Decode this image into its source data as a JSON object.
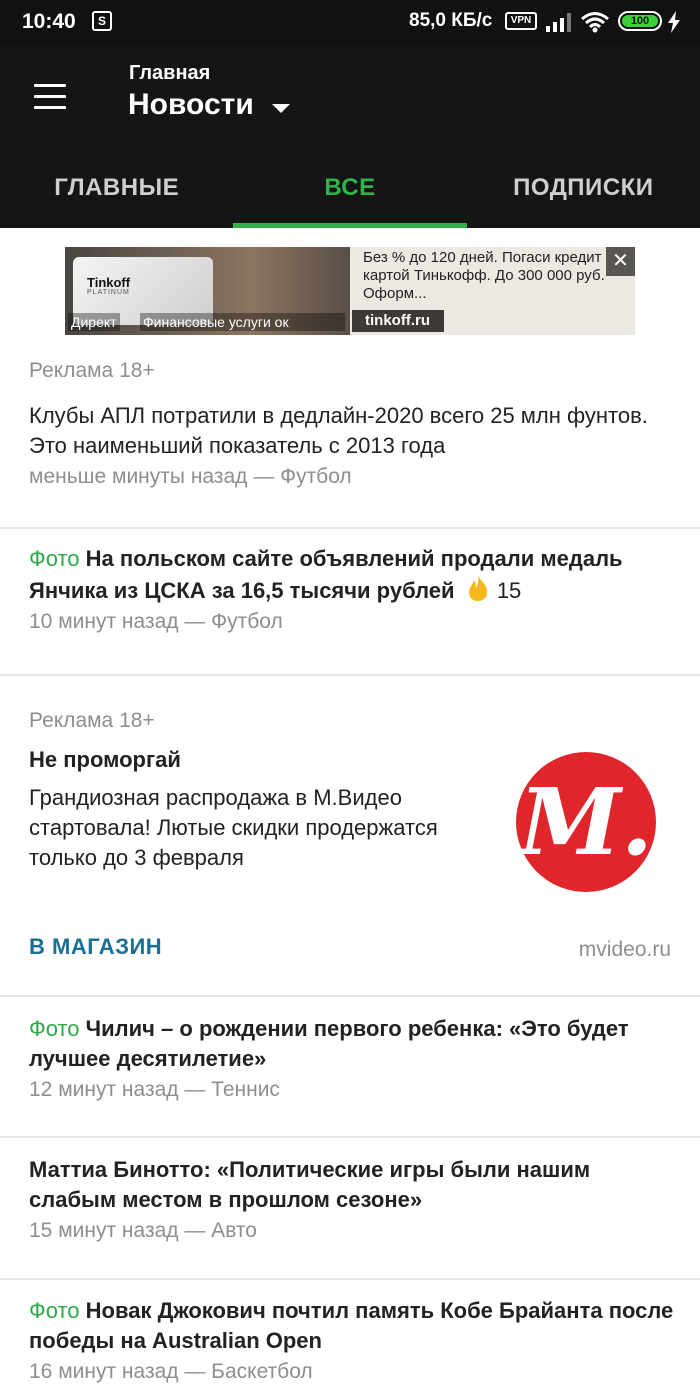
{
  "status_bar": {
    "time": "10:40",
    "notif_icon": "S",
    "speed": "85,0 КБ/с",
    "vpn": "VPN",
    "battery": "100"
  },
  "header": {
    "subtitle": "Главная",
    "title": "Новости"
  },
  "tabs": [
    {
      "label": "ГЛАВНЫЕ",
      "active": false
    },
    {
      "label": "ВСЕ",
      "active": true
    },
    {
      "label": "ПОДПИСКИ",
      "active": false
    }
  ],
  "banner": {
    "card_title": "Tinkoff",
    "card_sub": "PLATINUM",
    "direct": "Директ",
    "category": "Финансовые услуги ок",
    "text": "Без % до 120 дней. Погаси кредит картой Тинькофф. До 300 000 руб. Оформ...",
    "domain": "tinkoff.ru",
    "close": "✕"
  },
  "ad_label_1": "Реклама 18+",
  "news": [
    {
      "foto": "",
      "title": "Клубы АПЛ потратили в дедлайн-2020 всего 25 млн фунтов. Это наименьший показатель с 2013 года",
      "meta": "меньше минуты назад — Футбол",
      "count": ""
    },
    {
      "foto": "Фото",
      "title": "На польском сайте объявлений продали медаль Янчика из ЦСКА за 16,5 тысячи рублей",
      "meta": "10 минут назад — Футбол",
      "count": "15"
    },
    {
      "foto": "Фото",
      "title": "Чилич – о рождении первого ребенка: «Это будет лучшее десятилетие»",
      "meta": "12 минут назад — Теннис",
      "count": ""
    },
    {
      "foto": "",
      "title": "Маттиа Бинотто: «Политические игры были нашим слабым местом в прошлом сезоне»",
      "meta": "15 минут назад — Авто",
      "count": ""
    },
    {
      "foto": "Фото",
      "title": "Новак Джокович почтил память Кобе Брайанта после победы на Australian Open",
      "meta": "16 минут назад — Баскетбол",
      "count": ""
    }
  ],
  "ad2": {
    "label": "Реклама 18+",
    "title": "Не проморгай",
    "body": "Грандиозная распродажа в М.Видео стартовала! Лютые скидки продержатся только до 3 февраля",
    "logo_text": "М.",
    "button": "В МАГАЗИН",
    "domain": "mvideo.ru"
  },
  "colors": {
    "accent_green": "#2fb24a",
    "link_blue": "#1b6f93",
    "mvideo_red": "#e1262b",
    "header_bg": "#151515"
  },
  "icons": [
    "menu-icon",
    "caret-down-icon",
    "close-icon",
    "fire-icon",
    "wifi-icon",
    "signal-icon",
    "battery-icon",
    "bolt-icon"
  ]
}
